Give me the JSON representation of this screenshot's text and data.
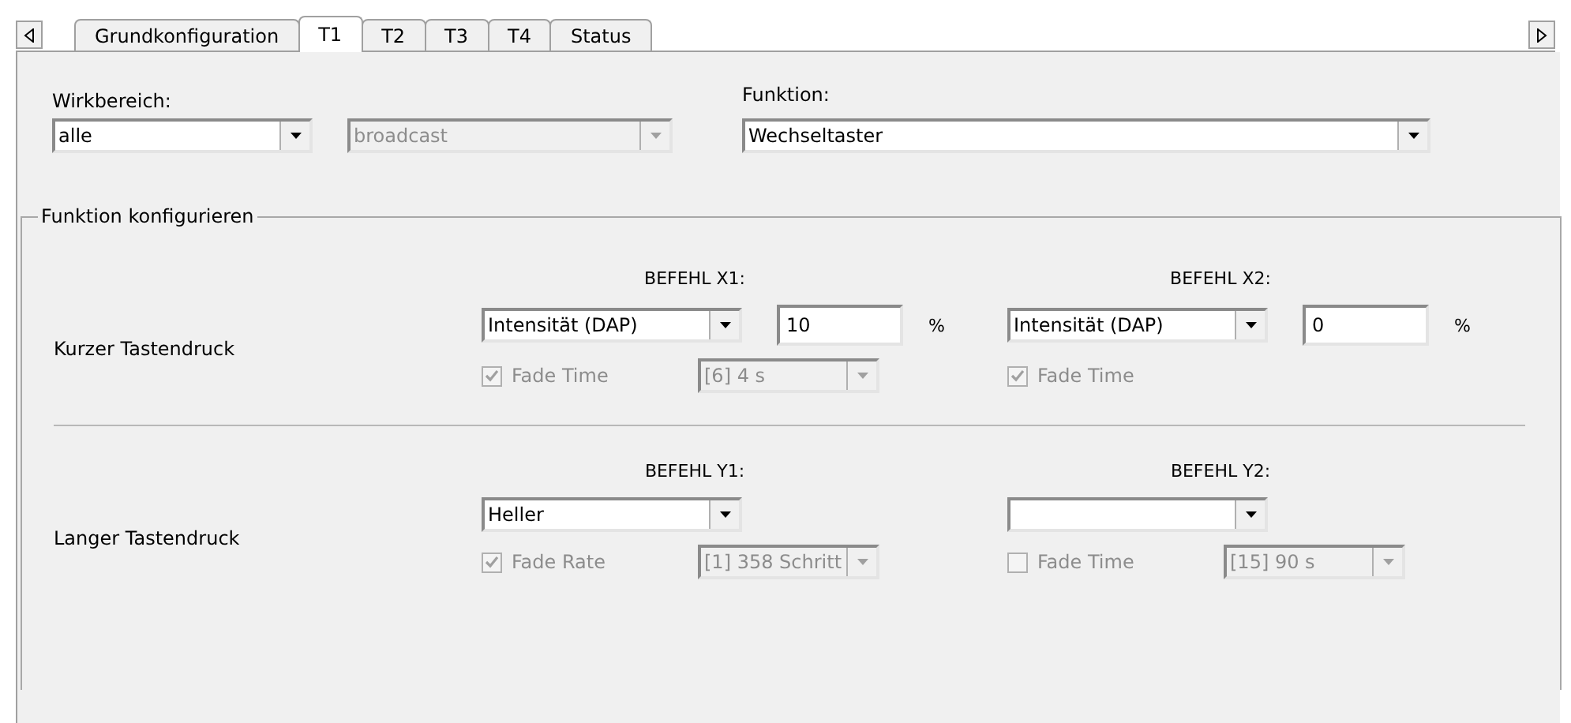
{
  "tabs": [
    {
      "label": "Grundkonfiguration",
      "selected": false
    },
    {
      "label": "T1",
      "selected": true
    },
    {
      "label": "T2",
      "selected": false
    },
    {
      "label": "T3",
      "selected": false
    },
    {
      "label": "T4",
      "selected": false
    },
    {
      "label": "Status",
      "selected": false
    }
  ],
  "scope": {
    "label": "Wirkbereich:",
    "select": {
      "value": "alle",
      "disabled": false
    },
    "target": {
      "value": "broadcast",
      "disabled": true
    }
  },
  "function": {
    "label": "Funktion:",
    "select": {
      "value": "Wechseltaster",
      "disabled": false
    }
  },
  "group": {
    "title": "Funktion konfigurieren",
    "sections": [
      {
        "label": "Kurzer Tastendruck",
        "commands": [
          {
            "header": "BEFEHL X1:",
            "select": {
              "value": "Intensität (DAP)"
            },
            "amount": {
              "value": "10",
              "unit": "%"
            },
            "option": {
              "label": "Fade Time",
              "checked": true,
              "disabled": true,
              "setting": {
                "value": "[6]  4 s",
                "disabled": true
              }
            }
          },
          {
            "header": "BEFEHL X2:",
            "select": {
              "value": "Intensität (DAP)"
            },
            "amount": {
              "value": "0",
              "unit": "%"
            },
            "option": {
              "label": "Fade Time",
              "checked": true,
              "disabled": true
            }
          }
        ]
      },
      {
        "label": "Langer Tastendruck",
        "commands": [
          {
            "header": "BEFEHL Y1:",
            "select": {
              "value": "Heller"
            },
            "option": {
              "label": "Fade Rate",
              "checked": true,
              "disabled": true,
              "setting": {
                "value": "[1] 358  Schritt",
                "disabled": true
              }
            }
          },
          {
            "header": "BEFEHL Y2:",
            "option": {
              "label": "Fade Time",
              "checked": false,
              "disabled": true,
              "setting": {
                "value": "[15]  90 s",
                "disabled": true
              }
            }
          }
        ]
      }
    ]
  }
}
